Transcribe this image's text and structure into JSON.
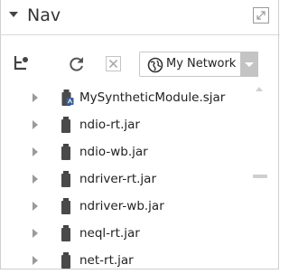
{
  "header": {
    "title": "Nav"
  },
  "toolbar": {
    "home_icon": "tree-root-icon",
    "refresh_icon": "refresh-icon",
    "close_icon": "close-icon",
    "network_select": {
      "value": "My Network",
      "icon": "globe-icon"
    }
  },
  "tree": {
    "items": [
      {
        "label": "MySyntheticModule.sjar",
        "icon": "synthetic-jar-icon"
      },
      {
        "label": "ndio-rt.jar",
        "icon": "jar-icon"
      },
      {
        "label": "ndio-wb.jar",
        "icon": "jar-icon"
      },
      {
        "label": "ndriver-rt.jar",
        "icon": "jar-icon"
      },
      {
        "label": "ndriver-wb.jar",
        "icon": "jar-icon"
      },
      {
        "label": "neql-rt.jar",
        "icon": "jar-icon"
      },
      {
        "label": "net-rt.jar",
        "icon": "jar-icon"
      }
    ]
  },
  "colors": {
    "jar": "#4a4a4a",
    "accent_badge": "#3b5e9b",
    "select_arrow_bg": "#c4c4c4"
  }
}
